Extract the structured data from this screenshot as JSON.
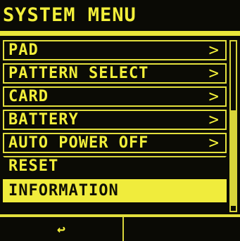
{
  "title": "SYSTEM MENU",
  "menu": {
    "items": [
      {
        "label": "PAD",
        "chevron": ">"
      },
      {
        "label": "PATTERN SELECT",
        "chevron": ">"
      },
      {
        "label": "CARD",
        "chevron": ">"
      },
      {
        "label": "BATTERY",
        "chevron": ">"
      },
      {
        "label": "AUTO POWER OFF",
        "chevron": ">"
      },
      {
        "label": "RESET"
      },
      {
        "label": "INFORMATION",
        "selected": true
      }
    ]
  },
  "softkeys": {
    "left_icon": "return-arrow-icon",
    "left_label": "↩",
    "right_label": ""
  },
  "colors": {
    "accent": "#f2ef3a",
    "background": "#0b0b05"
  }
}
